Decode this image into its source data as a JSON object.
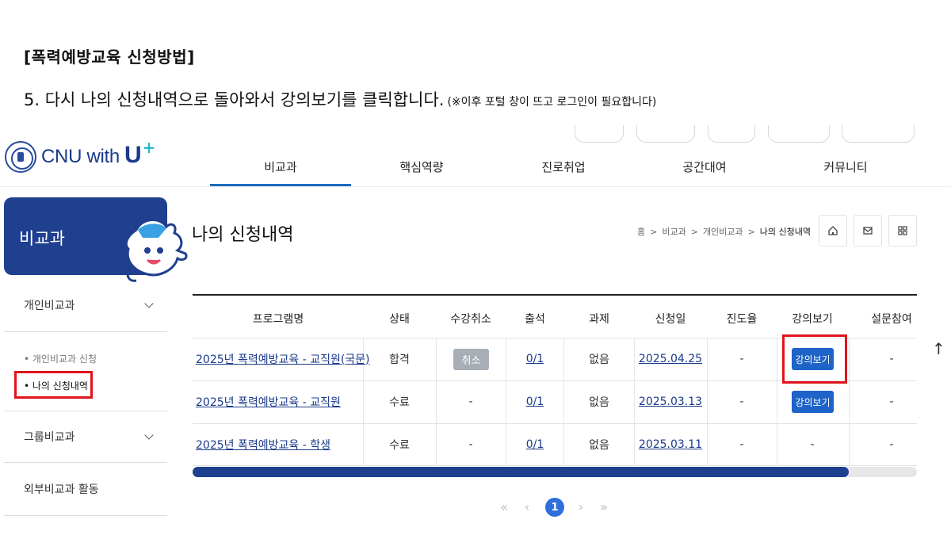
{
  "heading": "[폭력예방교육 신청방법]",
  "step": {
    "text": "5. 다시 나의 신청내역으로 돌아와서 강의보기를 클릭합니다.",
    "note": "(※이후 포털 창이 뜨고 로그인이 필요합니다)"
  },
  "logo": {
    "text": "CNU with",
    "mark": "U",
    "plus": "+"
  },
  "nav": [
    "비교과",
    "핵심역량",
    "진로취업",
    "공간대여",
    "커뮤니티"
  ],
  "sidebar": {
    "title": "비교과",
    "menu": {
      "personal": "개인비교과",
      "group": "그룹비교과",
      "external": "외부비교과 활동"
    },
    "sub": [
      "• 개인비교과 신청",
      "• 나의 신청내역"
    ]
  },
  "page_title": "나의 신청내역",
  "breadcrumb": {
    "home": "홈",
    "sep": ">",
    "items": [
      "비교과",
      "개인비교과",
      "나의 신청내역"
    ]
  },
  "table": {
    "headers": [
      "프로그램명",
      "상태",
      "수강취소",
      "출석",
      "과제",
      "신청일",
      "진도율",
      "강의보기",
      "설문참여"
    ],
    "rows": [
      {
        "program": "2025년 폭력예방교육 - 교직원(국문)",
        "status": "합격",
        "cancel": "취소",
        "attend": "0/1",
        "task": "없음",
        "date": "2025.04.25",
        "progress": "-",
        "lecture": "강의보기",
        "survey": "-"
      },
      {
        "program": "2025년 폭력예방교육 - 교직원",
        "status": "수료",
        "cancel": "-",
        "attend": "0/1",
        "task": "없음",
        "date": "2025.03.13",
        "progress": "-",
        "lecture": "강의보기",
        "survey": "-"
      },
      {
        "program": "2025년 폭력예방교육 - 학생",
        "status": "수료",
        "cancel": "-",
        "attend": "0/1",
        "task": "없음",
        "date": "2025.03.11",
        "progress": "-",
        "lecture": "-",
        "survey": "-"
      }
    ]
  },
  "pagination": {
    "first": "«",
    "prev": "‹",
    "current": "1",
    "next": "›",
    "last": "»"
  },
  "to_top": "↑",
  "colors": {
    "primary": "#1f3f8f",
    "accent": "#1e63c8",
    "highlight": "#e0141c"
  }
}
